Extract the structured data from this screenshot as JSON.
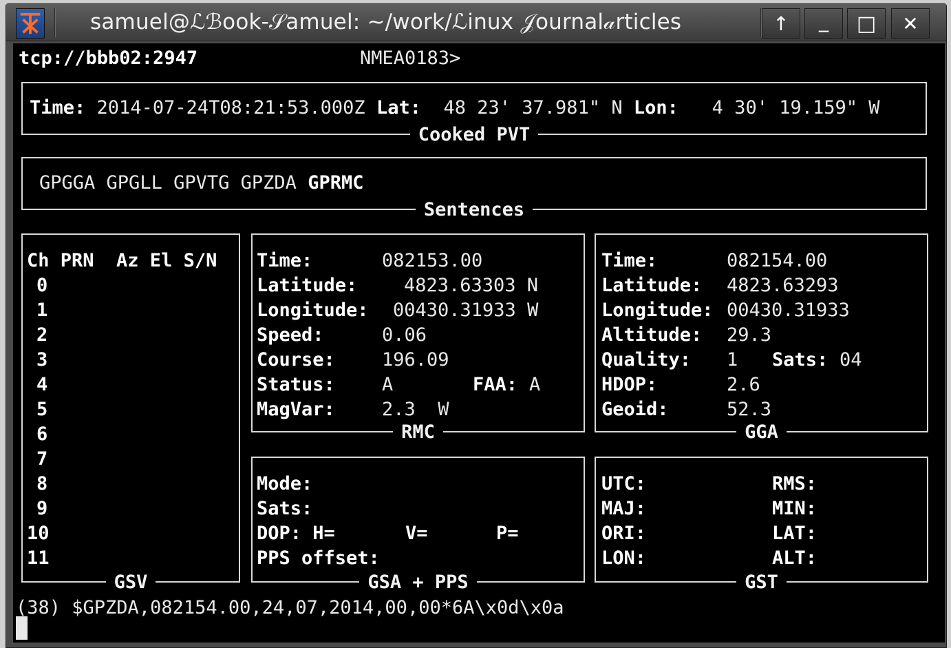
{
  "window": {
    "title": "samuel@ℒℬook-𝒮amuel: ~/work/ℒinux 𝒥ournal𝒶rticles",
    "buttons": {
      "up": "↑",
      "minimize": "_",
      "maximize": "□",
      "close": "✕"
    }
  },
  "header": {
    "host": "tcp://bbb02:2947",
    "prompt": "NMEA0183>"
  },
  "cooked_pvt": {
    "title": "Cooked PVT",
    "time_label": "Time:",
    "time_value": "2014-07-24T08:21:53.000Z",
    "lat_label": "Lat:",
    "lat_value": "48 23' 37.981\" N",
    "lon_label": "Lon:",
    "lon_value": "4 30' 19.159\" W"
  },
  "sentences": {
    "title": "Sentences",
    "items": [
      "GPGGA",
      "GPGLL",
      "GPVTG",
      "GPZDA"
    ],
    "active": "GPRMC"
  },
  "gsv": {
    "title": "GSV",
    "header": "Ch PRN  Az El S/N",
    "channels": [
      "0",
      "1",
      "2",
      "3",
      "4",
      "5",
      "6",
      "7",
      "8",
      "9",
      "10",
      "11"
    ]
  },
  "rmc": {
    "title": "RMC",
    "time_label": "Time:",
    "time_value": "082153.00",
    "lat_label": "Latitude:",
    "lat_value": "4823.63303 N",
    "lon_label": "Longitude:",
    "lon_value": "00430.31933 W",
    "speed_label": "Speed:",
    "speed_value": "0.06",
    "course_label": "Course:",
    "course_value": "196.09",
    "status_label": "Status:",
    "status_value": "A",
    "faa_label": "FAA:",
    "faa_value": "A",
    "magvar_label": "MagVar:",
    "magvar_value": "2.3  W"
  },
  "gga": {
    "title": "GGA",
    "time_label": "Time:",
    "time_value": "082154.00",
    "lat_label": "Latitude:",
    "lat_value": "4823.63293",
    "lon_label": "Longitude:",
    "lon_value": "00430.31933",
    "alt_label": "Altitude:",
    "alt_value": "29.3",
    "quality_label": "Quality:",
    "quality_value": "1",
    "sats_label": "Sats:",
    "sats_value": "04",
    "hdop_label": "HDOP:",
    "hdop_value": "2.6",
    "geoid_label": "Geoid:",
    "geoid_value": "52.3"
  },
  "gsa": {
    "title": "GSA + PPS",
    "mode_label": "Mode:",
    "sats_label": "Sats:",
    "dop_label": "DOP: H=",
    "v_label": "V=",
    "p_label": "P=",
    "pps_label": "PPS offset:"
  },
  "gst": {
    "title": "GST",
    "utc_label": "UTC:",
    "rms_label": "RMS:",
    "maj_label": "MAJ:",
    "min_label": "MIN:",
    "ori_label": "ORI:",
    "lat_label": "LAT:",
    "lon_label": "LON:",
    "alt_label": "ALT:"
  },
  "log": {
    "line": "(38) $GPZDA,082154.00,24,07,2014,00,00*6A\\x0d\\x0a"
  }
}
